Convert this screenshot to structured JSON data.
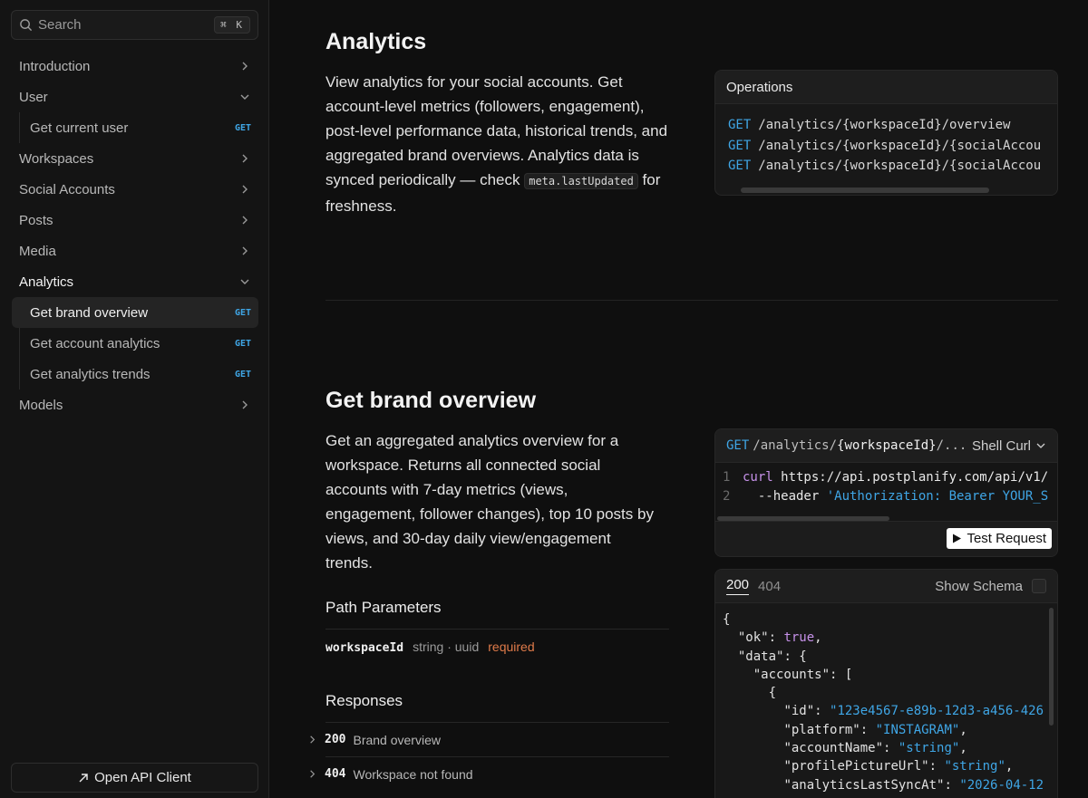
{
  "sidebar": {
    "search_placeholder": "Search",
    "search_shortcut": "⌘ K",
    "items": [
      {
        "label": "Introduction"
      },
      {
        "label": "User"
      },
      {
        "label": "Get current user",
        "method": "GET"
      },
      {
        "label": "Workspaces"
      },
      {
        "label": "Social Accounts"
      },
      {
        "label": "Posts"
      },
      {
        "label": "Media"
      },
      {
        "label": "Analytics"
      },
      {
        "label": "Get brand overview",
        "method": "GET"
      },
      {
        "label": "Get account analytics",
        "method": "GET"
      },
      {
        "label": "Get analytics trends",
        "method": "GET"
      },
      {
        "label": "Models"
      }
    ],
    "open_client": "Open API Client"
  },
  "analytics": {
    "title": "Analytics",
    "desc_before": "View analytics for your social accounts. Get account-level metrics (followers, engagement), post-level performance data, historical trends, and aggregated brand overviews. Analytics data is synced periodically — check ",
    "desc_code": "meta.lastUpdated",
    "desc_after": " for freshness.",
    "operations_title": "Operations",
    "operations": [
      {
        "method": "GET",
        "path": "/analytics/{workspaceId}/overview"
      },
      {
        "method": "GET",
        "path": "/analytics/{workspaceId}/{socialAccou"
      },
      {
        "method": "GET",
        "path": "/analytics/{workspaceId}/{socialAccou"
      }
    ]
  },
  "brand_overview": {
    "title": "Get brand overview",
    "description": "Get an aggregated analytics overview for a workspace. Returns all connected social accounts with 7-day metrics (views, engagement, follower changes), top 10 posts by views, and 30-day daily view/engagement trends.",
    "path_params_title": "Path Parameters",
    "param_name": "workspaceId",
    "param_type": "string · uuid",
    "param_required": "required",
    "responses_title": "Responses",
    "responses": [
      {
        "code": "200",
        "text": "Brand overview"
      },
      {
        "code": "404",
        "text": "Workspace not found"
      }
    ],
    "request": {
      "method": "GET",
      "path_prefix": "/analytics/",
      "path_bold": "{workspaceId}",
      "path_suffix": "/...",
      "lang": "Shell Curl",
      "line1_cmd": "curl",
      "line1_rest": " https://api.postplanify.com/api/v1/",
      "line2_flag": "  --header ",
      "line2_str": "'Authorization: Bearer YOUR_S",
      "test_button": "Test Request"
    },
    "response_panel": {
      "tab_200": "200",
      "tab_404": "404",
      "show_schema": "Show Schema"
    }
  },
  "colors": {
    "accent": "#3fa6e6",
    "required": "#e07b4a",
    "keyword": "#c792ea"
  }
}
